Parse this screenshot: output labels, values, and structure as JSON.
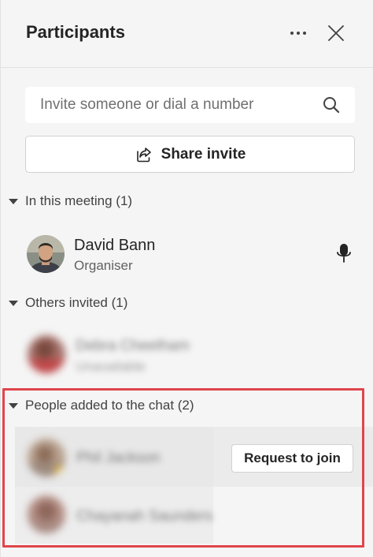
{
  "header": {
    "title": "Participants",
    "more_icon": "more-horizontal-icon",
    "close_icon": "close-icon"
  },
  "search": {
    "placeholder": "Invite someone or dial a number",
    "icon": "search-icon"
  },
  "share": {
    "label": "Share invite",
    "icon": "share-icon"
  },
  "sections": {
    "in_meeting": {
      "label": "In this meeting (1)"
    },
    "others_invited": {
      "label": "Others invited (1)"
    },
    "people_added": {
      "label": "People added to the chat (2)"
    }
  },
  "in_meeting_participants": [
    {
      "name": "David Bann",
      "role": "Organiser",
      "status_icon": "microphone-icon"
    }
  ],
  "others_invited_participants": [
    {
      "name": "Debra Cheetham",
      "role": "Unavailable"
    }
  ],
  "chat_participants": [
    {
      "name": "Phil Jackson",
      "action_label": "Request to join"
    },
    {
      "name": "Chayanah Saunders"
    }
  ],
  "colors": {
    "highlight": "#e0454c",
    "panel": "#f5f5f5",
    "text": "#242424"
  }
}
